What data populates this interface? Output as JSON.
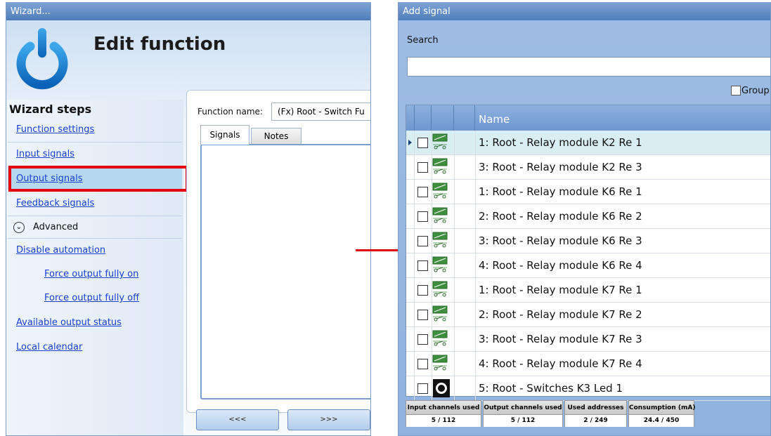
{
  "wizard": {
    "title": "Wizard...",
    "heading": "Edit function",
    "steps_title": "Wizard steps",
    "steps": [
      "Function settings",
      "Input signals",
      "Output signals",
      "Feedback signals"
    ],
    "advanced_label": "Advanced",
    "advanced_steps": [
      "Disable automation",
      "Force output fully on",
      "Force output fully off",
      "Available output status",
      "Local calendar"
    ],
    "function_name_label": "Function name:",
    "function_name_value": "(Fx) Root - Switch Fu",
    "tabs": [
      "Signals",
      "Notes"
    ],
    "back_button": "<<<",
    "next_button": ">>>"
  },
  "add_signal": {
    "title": "Add signal",
    "search_label": "Search",
    "search_value": "",
    "group_label": "Group",
    "column_name": "Name",
    "rows": [
      {
        "name": "1: Root - Relay module K2 Re 1",
        "icon": "relay-icon"
      },
      {
        "name": "3: Root - Relay module K2 Re 3",
        "icon": "relay-icon"
      },
      {
        "name": "1: Root - Relay module K6 Re 1",
        "icon": "relay-icon"
      },
      {
        "name": "2: Root - Relay module K6 Re 2",
        "icon": "relay-icon"
      },
      {
        "name": "3: Root - Relay module K6 Re 3",
        "icon": "relay-icon"
      },
      {
        "name": "4: Root - Relay module K6 Re 4",
        "icon": "relay-icon"
      },
      {
        "name": "1: Root - Relay module K7 Re 1",
        "icon": "relay-icon"
      },
      {
        "name": "2: Root - Relay module K7 Re 2",
        "icon": "relay-icon"
      },
      {
        "name": "3: Root - Relay module K7 Re 3",
        "icon": "relay-icon"
      },
      {
        "name": "4: Root - Relay module K7 Re 4",
        "icon": "relay-icon"
      },
      {
        "name": "5: Root - Switches K3 Led 1",
        "icon": "led-icon"
      }
    ],
    "stats": [
      {
        "label": "Input channels used",
        "value": "5 / 112"
      },
      {
        "label": "Output channels used",
        "value": "5 / 112"
      },
      {
        "label": "Used addresses",
        "value": "2 / 249"
      },
      {
        "label": "Consumption (mA)",
        "value": "24.4 / 450"
      }
    ]
  },
  "colors": {
    "highlight": "#e3000f",
    "link": "#1a3fd0",
    "title_bar": "#5f8cc6",
    "selected_row": "#d8eef2"
  }
}
